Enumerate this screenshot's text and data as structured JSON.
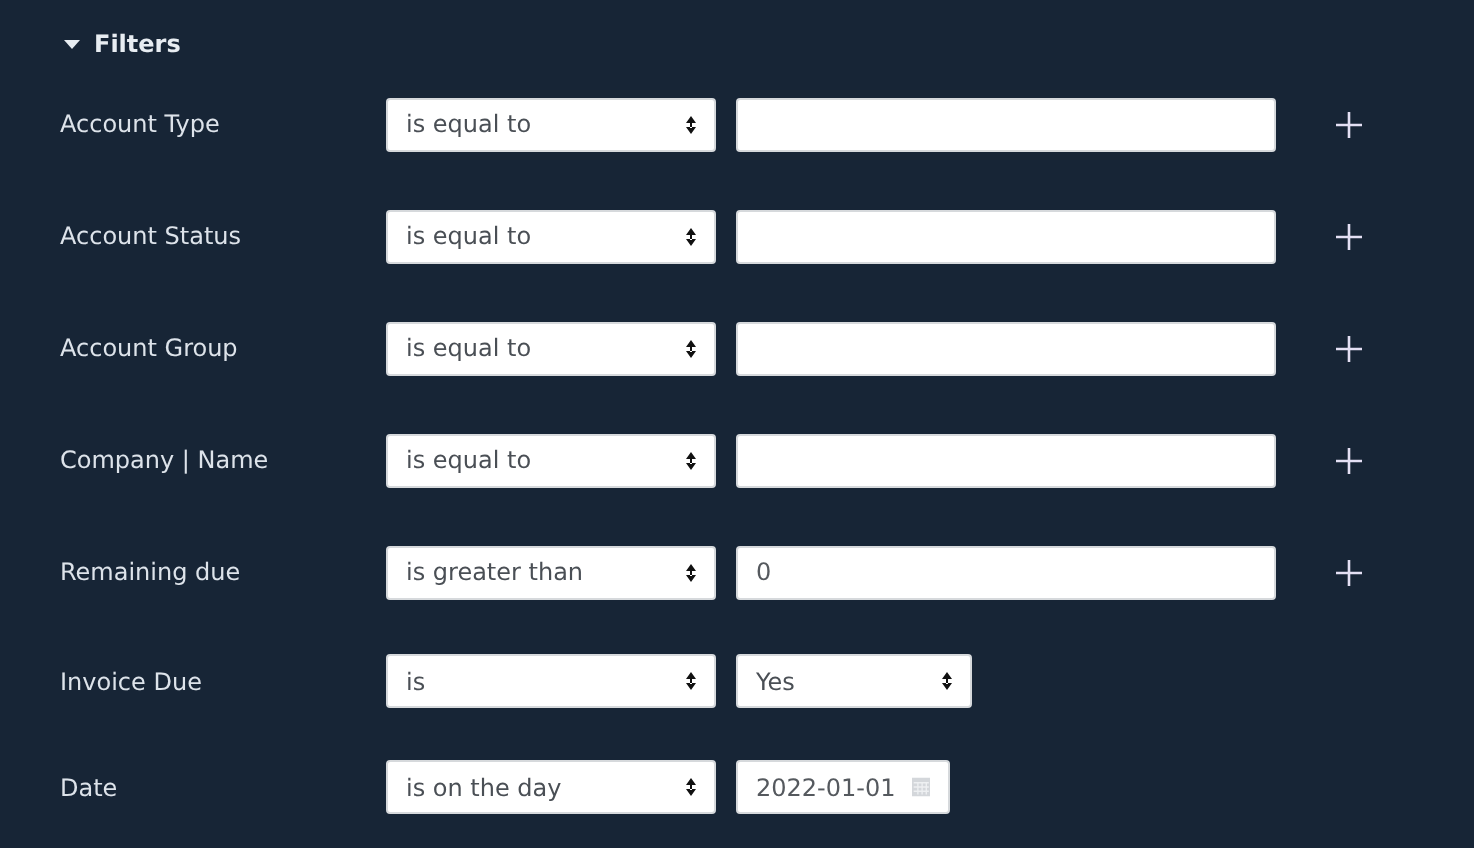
{
  "section": {
    "title": "Filters",
    "expanded": true
  },
  "filters": [
    {
      "label": "Account Type",
      "operator": "is equal to",
      "kind": "text",
      "addable": true
    },
    {
      "label": "Account Status",
      "operator": "is equal to",
      "kind": "text",
      "addable": true
    },
    {
      "label": "Account Group",
      "operator": "is equal to",
      "kind": "text",
      "addable": true
    },
    {
      "label": "Company | Name",
      "operator": "is equal to",
      "kind": "text",
      "addable": true
    },
    {
      "label": "Remaining due",
      "operator": "is greater than",
      "kind": "text",
      "value": "0",
      "addable": true
    },
    {
      "label": "Invoice Due",
      "operator": "is",
      "kind": "select",
      "value": "Yes",
      "addable": false
    },
    {
      "label": "Date",
      "operator": "is on the day",
      "kind": "date",
      "value": "2022-01-01",
      "addable": false
    }
  ]
}
